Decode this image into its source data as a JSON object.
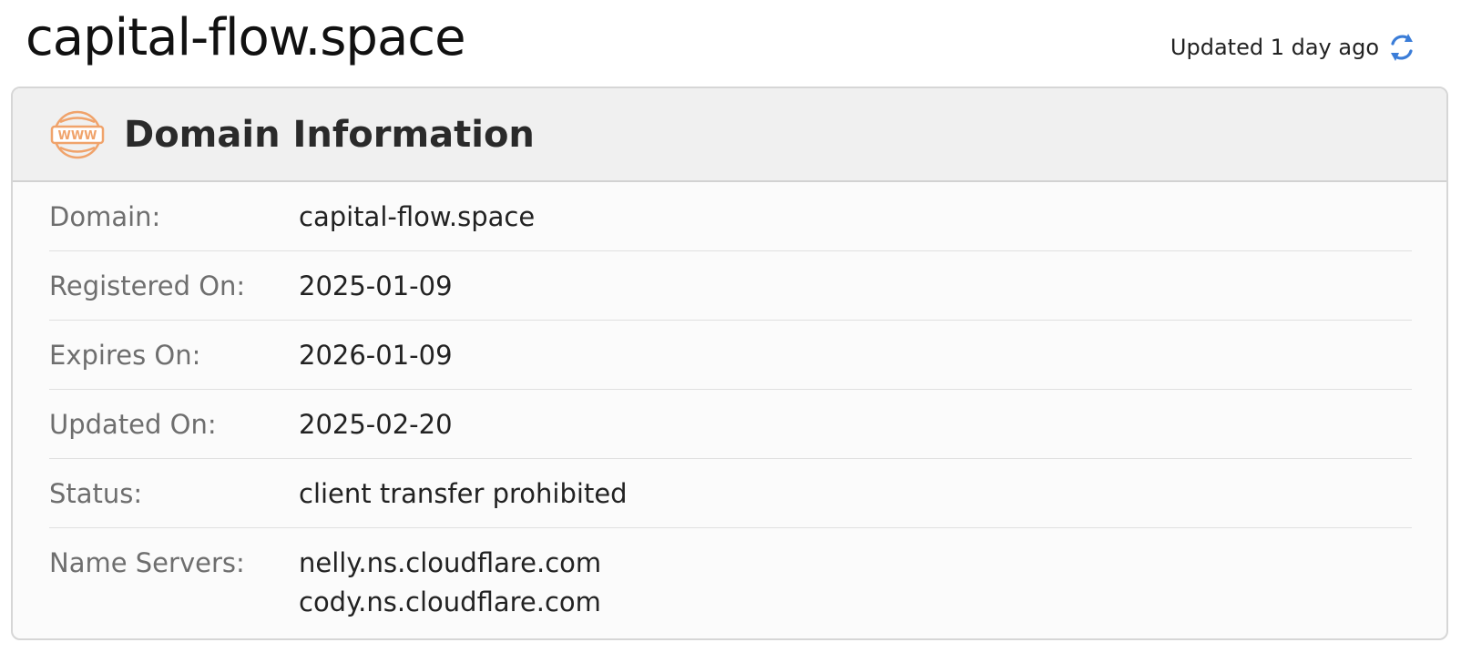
{
  "page": {
    "title": "capital-flow.space",
    "updated_text": "Updated 1 day ago",
    "refresh_icon": "refresh-icon"
  },
  "card": {
    "icon": "www-icon",
    "title": "Domain Information",
    "rows": [
      {
        "label": "Domain:",
        "value": "capital-flow.space"
      },
      {
        "label": "Registered On:",
        "value": "2025-01-09"
      },
      {
        "label": "Expires On:",
        "value": "2026-01-09"
      },
      {
        "label": "Updated On:",
        "value": "2025-02-20"
      },
      {
        "label": "Status:",
        "value": "client transfer prohibited"
      },
      {
        "label": "Name Servers:",
        "values": [
          "nelly.ns.cloudflare.com",
          "cody.ns.cloudflare.com"
        ]
      }
    ]
  },
  "colors": {
    "accent_blue": "#3b7dd8",
    "www_orange": "#f0a36b",
    "header_bg": "#f0f0f0",
    "label_gray": "#6e6e6e"
  }
}
